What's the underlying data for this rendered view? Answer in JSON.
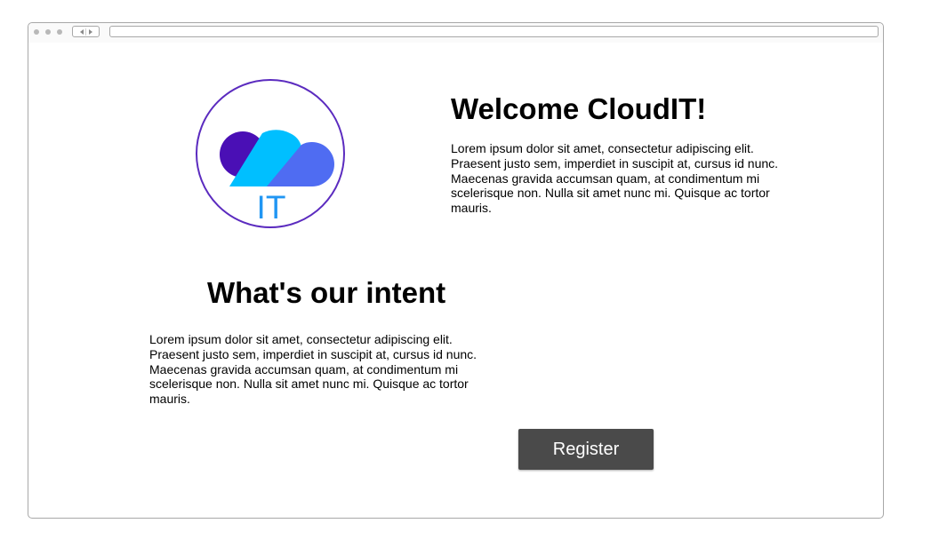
{
  "welcome": {
    "title": "Welcome CloudIT!",
    "text": "Lorem ipsum dolor sit amet, consectetur adipiscing elit. Praesent justo sem, imperdiet in suscipit at, cursus id nunc. Maecenas gravida accumsan quam, at condimentum mi scelerisque non. Nulla sit amet nunc mi. Quisque ac tortor mauris."
  },
  "intent": {
    "title": "What's our intent",
    "text": "Lorem ipsum dolor sit amet, consectetur adipiscing elit. Praesent justo sem, imperdiet in suscipit at, cursus id nunc. Maecenas gravida accumsan quam, at condimentum mi scelerisque non. Nulla sit amet nunc mi. Quisque ac tortor mauris."
  },
  "logo": {
    "text": "IT",
    "icon": "cloud-icon",
    "colors": {
      "ring": "#5b2bbf",
      "cloud_dark": "#4a0fb5",
      "cloud_light": "#00bfff",
      "cloud_mid": "#4f6cf2",
      "text": "#2196f3"
    }
  },
  "actions": {
    "register_label": "Register"
  },
  "colors": {
    "button_bg": "#4a4a4a",
    "button_text": "#ffffff"
  }
}
